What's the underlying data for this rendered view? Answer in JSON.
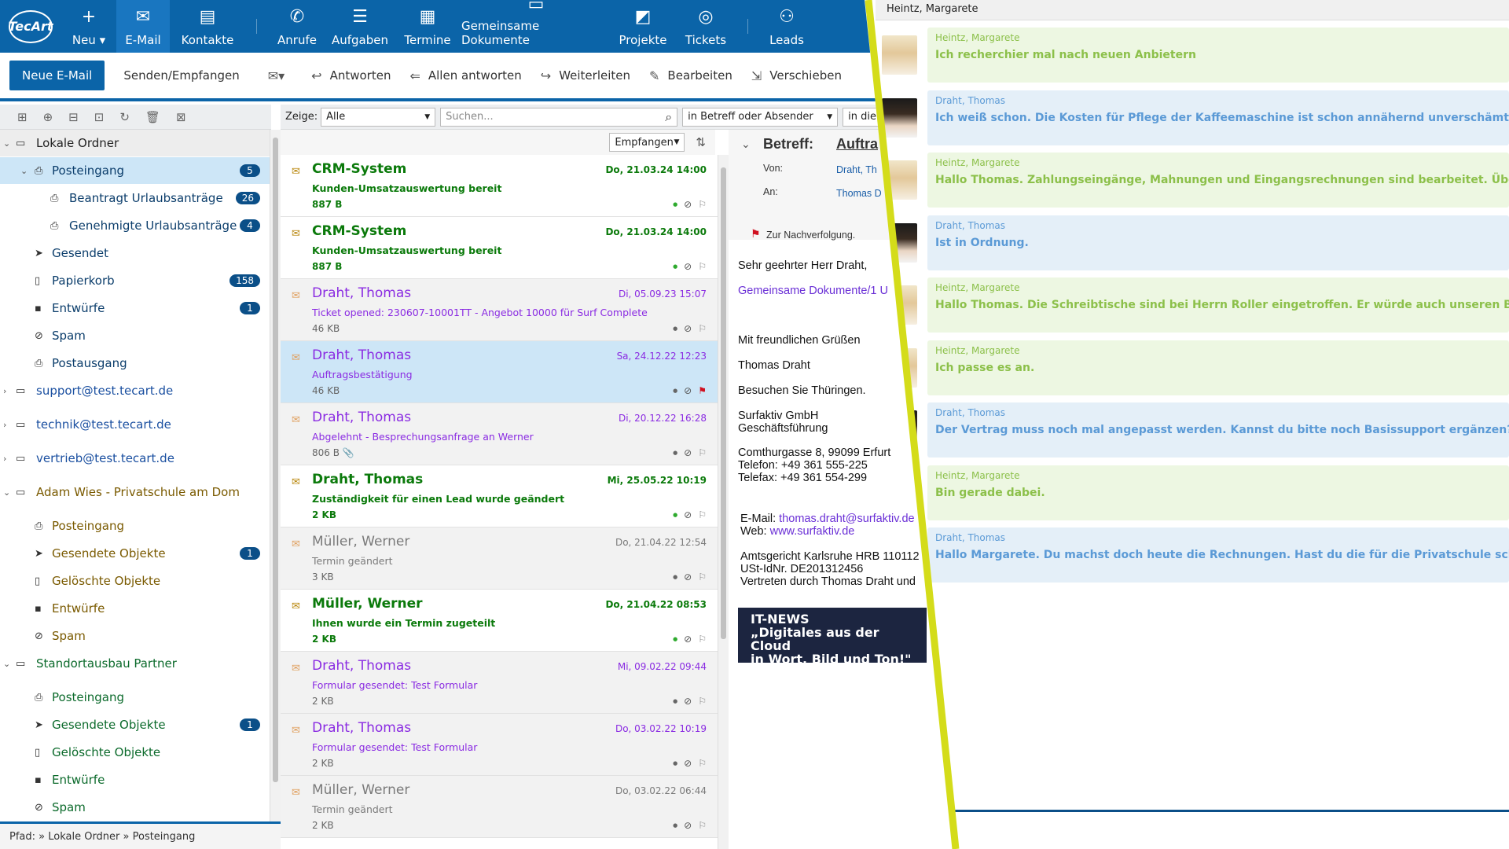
{
  "brand": {
    "logo": "TecArt"
  },
  "nav": [
    {
      "label": "Neu ▾",
      "icon": "+"
    },
    {
      "label": "E-Mail",
      "icon": "✉"
    },
    {
      "label": "Kontakte",
      "icon": "▤"
    },
    {
      "label": "Anrufe",
      "icon": "✆"
    },
    {
      "label": "Aufgaben",
      "icon": "☰"
    },
    {
      "label": "Termine",
      "icon": "▦"
    },
    {
      "label": "Gemeinsame Dokumente",
      "icon": "▭"
    },
    {
      "label": "Projekte",
      "icon": "◩"
    },
    {
      "label": "Tickets",
      "icon": "◎"
    },
    {
      "label": "Leads",
      "icon": "⚇"
    }
  ],
  "toolbar": {
    "new_mail": "Neue E-Mail",
    "send_receive": "Senden/Empfangen",
    "reply": "Antworten",
    "reply_all": "Allen antworten",
    "forward": "Weiterleiten",
    "edit": "Bearbeiten",
    "move": "Verschieben"
  },
  "folders": [
    {
      "label": "Lokale Ordner",
      "level": 0,
      "type": "account",
      "expanded": true
    },
    {
      "label": "Posteingang",
      "level": 1,
      "type": "inbox",
      "badge": "5",
      "selected": true,
      "expanded": true
    },
    {
      "label": "Beantragt Urlaubsanträge",
      "level": 2,
      "type": "folder",
      "badge": "26"
    },
    {
      "label": "Genehmigte Urlaubsanträge",
      "level": 2,
      "type": "folder",
      "badge": "4"
    },
    {
      "label": "Gesendet",
      "level": 1,
      "type": "sent"
    },
    {
      "label": "Papierkorb",
      "level": 1,
      "type": "trash",
      "badge": "158"
    },
    {
      "label": "Entwürfe",
      "level": 1,
      "type": "draft",
      "badge": "1"
    },
    {
      "label": "Spam",
      "level": 1,
      "type": "spam"
    },
    {
      "label": "Postausgang",
      "level": 1,
      "type": "outbox"
    },
    {
      "label": "support@test.tecart.de",
      "level": 0,
      "type": "account",
      "expanded": false
    },
    {
      "label": "technik@test.tecart.de",
      "level": 0,
      "type": "account",
      "expanded": false
    },
    {
      "label": "vertrieb@test.tecart.de",
      "level": 0,
      "type": "account",
      "expanded": false
    },
    {
      "label": "Adam Wies - Privatschule am Dom",
      "level": 0,
      "type": "account",
      "expanded": true
    },
    {
      "label": "Posteingang",
      "level": 1,
      "type": "inbox"
    },
    {
      "label": "Gesendete Objekte",
      "level": 1,
      "type": "sent",
      "badge": "1"
    },
    {
      "label": "Gelöschte Objekte",
      "level": 1,
      "type": "trash"
    },
    {
      "label": "Entwürfe",
      "level": 1,
      "type": "draft"
    },
    {
      "label": "Spam",
      "level": 1,
      "type": "spam"
    },
    {
      "label": "Standortausbau Partner",
      "level": 0,
      "type": "account",
      "expanded": true
    },
    {
      "label": "Posteingang",
      "level": 1,
      "type": "inbox"
    },
    {
      "label": "Gesendete Objekte",
      "level": 1,
      "type": "sent",
      "badge": "1"
    },
    {
      "label": "Gelöschte Objekte",
      "level": 1,
      "type": "trash"
    },
    {
      "label": "Entwürfe",
      "level": 1,
      "type": "draft"
    },
    {
      "label": "Spam",
      "level": 1,
      "type": "spam"
    }
  ],
  "path": "Pfad: » Lokale Ordner » Posteingang",
  "filter": {
    "show_label": "Zeige:",
    "show_value": "Alle",
    "search_placeholder": "Suchen...",
    "scope_value": "in Betreff oder Absender",
    "scope2_value": "in die",
    "sort_value": "Empfangen"
  },
  "mails": [
    {
      "from": "CRM-System",
      "subject": "Kunden-Umsatzauswertung bereit",
      "size": "887 B",
      "date": "Do, 21.03.24 14:00",
      "state": "unread"
    },
    {
      "from": "CRM-System",
      "subject": "Kunden-Umsatzauswertung bereit",
      "size": "887 B",
      "date": "Do, 21.03.24 14:00",
      "state": "unread"
    },
    {
      "from": "Draht, Thomas",
      "subject": "Ticket opened: 230607-10001TT - Angebot 10000 für Surf Complete",
      "size": "46 KB",
      "date": "Di, 05.09.23 15:07",
      "state": "read"
    },
    {
      "from": "Draht, Thomas",
      "subject": "Auftragsbestätigung",
      "size": "46 KB",
      "date": "Sa, 24.12.22 12:23",
      "state": "read-selected",
      "flag": true
    },
    {
      "from": "Draht, Thomas",
      "subject": "Abgelehnt - Besprechungsanfrage an Werner",
      "size": "806 B",
      "date": "Di, 20.12.22 16:28",
      "state": "read",
      "attachment": true
    },
    {
      "from": "Draht, Thomas",
      "subject": "Zuständigkeit für einen Lead wurde geändert",
      "size": "2 KB",
      "date": "Mi, 25.05.22 10:19",
      "state": "unread"
    },
    {
      "from": "Müller, Werner",
      "subject": "Termin geändert",
      "size": "3 KB",
      "date": "Do, 21.04.22 12:54",
      "state": "read-grey"
    },
    {
      "from": "Müller, Werner",
      "subject": "Ihnen wurde ein Termin zugeteilt",
      "size": "2 KB",
      "date": "Do, 21.04.22 08:53",
      "state": "unread"
    },
    {
      "from": "Draht, Thomas",
      "subject": "Formular gesendet: Test Formular",
      "size": "2 KB",
      "date": "Mi, 09.02.22 09:44",
      "state": "read"
    },
    {
      "from": "Draht, Thomas",
      "subject": "Formular gesendet: Test Formular",
      "size": "2 KB",
      "date": "Do, 03.02.22 10:19",
      "state": "read"
    },
    {
      "from": "Müller, Werner",
      "subject": "Termin geändert",
      "size": "2 KB",
      "date": "Do, 03.02.22 06:44",
      "state": "read-grey"
    }
  ],
  "preview": {
    "subject_label": "Betreff:",
    "subject_value": "Auftra",
    "from_label": "Von:",
    "from_value": "Draht, Th",
    "to_label": "An:",
    "to_value": "Thomas D",
    "followup": "Zur Nachverfolgung.",
    "body": [
      {
        "text": "Sehr geehrter Herr Draht,",
        "link": false
      },
      {
        "text": "Gemeinsame Dokumente/1 U",
        "link": true
      },
      {
        "text": "Mit freundlichen Grüßen",
        "link": false
      },
      {
        "text": "Thomas Draht",
        "link": false
      },
      {
        "text": "Besuchen Sie Thüringen.",
        "link": false
      },
      {
        "text": "Surfaktiv GmbH",
        "link": false
      },
      {
        "text": "Geschäftsführung",
        "link": false
      },
      {
        "text": "Comthurgasse 8, 99099 Erfurt",
        "link": false
      },
      {
        "text": "Telefon: +49 361 555-225",
        "link": false
      },
      {
        "text": "Telefax: +49 361 554-299",
        "link": false
      },
      {
        "text": "E-Mail: ",
        "link": false
      },
      {
        "text": "thomas.draht@surfaktiv.de",
        "link": true
      },
      {
        "text": "Web: ",
        "link": false
      },
      {
        "text": "www.surfaktiv.de",
        "link": true
      },
      {
        "text": "Amtsgericht Karlsruhe HRB 110112",
        "link": false
      },
      {
        "text": "USt-IdNr. DE201312456",
        "link": false
      },
      {
        "text": "Vertreten durch Thomas Draht und",
        "link": false
      }
    ],
    "banner_title": "IT-NEWS",
    "banner_line1": "„Digitales aus der Cloud",
    "banner_line2": "in Wort, Bild und Ton!\""
  },
  "chat": {
    "title": "Heintz, Margarete",
    "messages": [
      {
        "author": "Heintz, Margarete",
        "text": "Ich recherchier mal nach neuen Anbietern",
        "side": "green"
      },
      {
        "author": "Draht, Thomas",
        "text": "Ich weiß schon. Die Kosten für Pflege der Kaffeemaschine ist schon annähernd unverschämt.",
        "side": "blue"
      },
      {
        "author": "Heintz, Margarete",
        "text": "Hallo Thomas. Zahlungseingänge, Mahnungen und Eingangsrechnungen sind bearbeitet. Über die e",
        "side": "green"
      },
      {
        "author": "Draht, Thomas",
        "text": "Ist in Ordnung.",
        "side": "blue"
      },
      {
        "author": "Heintz, Margarete",
        "text": "Hallo Thomas. Die Schreibtische sind bei Herrn Roller eingetroffen. Er würde auch unseren Beamer",
        "side": "green"
      },
      {
        "author": "Heintz, Margarete",
        "text": "Ich passe es an.",
        "side": "green"
      },
      {
        "author": "Draht, Thomas",
        "text": "Der Vertrag muss noch mal angepasst werden. Kannst du bitte noch Basissupport ergänzen? Mail li",
        "side": "blue"
      },
      {
        "author": "Heintz, Margarete",
        "text": "Bin gerade dabei.",
        "side": "green"
      },
      {
        "author": "Draht, Thomas",
        "text": "Hallo Margarete. Du machst doch heute die Rechnungen. Hast du die für die Privatschule schon ver",
        "side": "blue"
      }
    ]
  },
  "colors": {
    "brand": "#0b64a8",
    "unread": "#0b7a0b",
    "read": "#8a2be2",
    "divider": "#d4dc1a",
    "badge": "#0b4f88"
  }
}
